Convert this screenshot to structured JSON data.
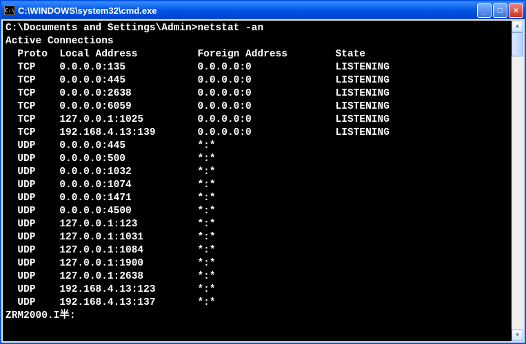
{
  "titlebar": {
    "icon_text": "C:\\",
    "title": "C:\\WINDOWS\\system32\\cmd.exe"
  },
  "terminal": {
    "prompt_line": "C:\\Documents and Settings\\Admin>netstat -an",
    "blank": "",
    "header": "Active Connections",
    "columns": {
      "proto": "Proto",
      "local": "Local Address",
      "foreign": "Foreign Address",
      "state": "State"
    },
    "rows": [
      {
        "proto": "TCP",
        "local": "0.0.0.0:135",
        "foreign": "0.0.0.0:0",
        "state": "LISTENING"
      },
      {
        "proto": "TCP",
        "local": "0.0.0.0:445",
        "foreign": "0.0.0.0:0",
        "state": "LISTENING"
      },
      {
        "proto": "TCP",
        "local": "0.0.0.0:2638",
        "foreign": "0.0.0.0:0",
        "state": "LISTENING"
      },
      {
        "proto": "TCP",
        "local": "0.0.0.0:6059",
        "foreign": "0.0.0.0:0",
        "state": "LISTENING"
      },
      {
        "proto": "TCP",
        "local": "127.0.0.1:1025",
        "foreign": "0.0.0.0:0",
        "state": "LISTENING"
      },
      {
        "proto": "TCP",
        "local": "192.168.4.13:139",
        "foreign": "0.0.0.0:0",
        "state": "LISTENING"
      },
      {
        "proto": "UDP",
        "local": "0.0.0.0:445",
        "foreign": "*:*",
        "state": ""
      },
      {
        "proto": "UDP",
        "local": "0.0.0.0:500",
        "foreign": "*:*",
        "state": ""
      },
      {
        "proto": "UDP",
        "local": "0.0.0.0:1032",
        "foreign": "*:*",
        "state": ""
      },
      {
        "proto": "UDP",
        "local": "0.0.0.0:1074",
        "foreign": "*:*",
        "state": ""
      },
      {
        "proto": "UDP",
        "local": "0.0.0.0:1471",
        "foreign": "*:*",
        "state": ""
      },
      {
        "proto": "UDP",
        "local": "0.0.0.0:4500",
        "foreign": "*:*",
        "state": ""
      },
      {
        "proto": "UDP",
        "local": "127.0.0.1:123",
        "foreign": "*:*",
        "state": ""
      },
      {
        "proto": "UDP",
        "local": "127.0.0.1:1031",
        "foreign": "*:*",
        "state": ""
      },
      {
        "proto": "UDP",
        "local": "127.0.0.1:1084",
        "foreign": "*:*",
        "state": ""
      },
      {
        "proto": "UDP",
        "local": "127.0.0.1:1900",
        "foreign": "*:*",
        "state": ""
      },
      {
        "proto": "UDP",
        "local": "127.0.0.1:2638",
        "foreign": "*:*",
        "state": ""
      },
      {
        "proto": "UDP",
        "local": "192.168.4.13:123",
        "foreign": "*:*",
        "state": ""
      },
      {
        "proto": "UDP",
        "local": "192.168.4.13:137",
        "foreign": "*:*",
        "state": ""
      }
    ],
    "footer": "ZRM2000.I半:"
  },
  "layout": {
    "col_proto_pad": 2,
    "col_proto_width": 7,
    "col_local_width": 23,
    "col_foreign_width": 23
  }
}
